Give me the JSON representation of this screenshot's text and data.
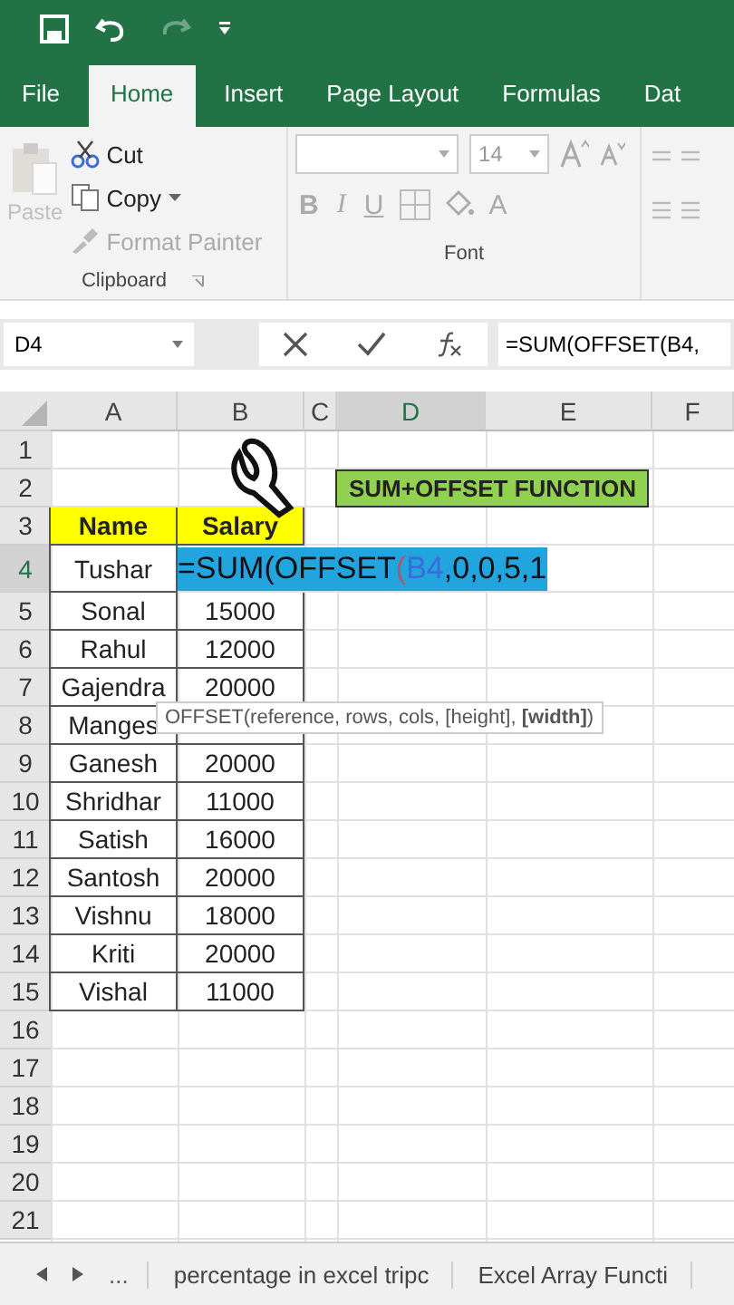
{
  "quick_access": {
    "undo_enabled": true,
    "redo_enabled": false
  },
  "tabs": [
    {
      "label": "File",
      "selected": false
    },
    {
      "label": "Home",
      "selected": true
    },
    {
      "label": "Insert",
      "selected": false
    },
    {
      "label": "Page Layout",
      "selected": false
    },
    {
      "label": "Formulas",
      "selected": false
    },
    {
      "label": "Dat",
      "selected": false
    }
  ],
  "clipboard": {
    "paste": {
      "label": "Paste",
      "disabled": true
    },
    "cut": "Cut",
    "copy": "Copy",
    "format_painter": {
      "label": "Format Painter",
      "disabled": true
    },
    "group_label": "Clipboard"
  },
  "font": {
    "size": "14",
    "style_buttons": [
      {
        "kind": "bold",
        "label": "B"
      },
      {
        "kind": "italic",
        "label": "I"
      },
      {
        "kind": "underline",
        "label": "U"
      }
    ],
    "font_color": "A",
    "group_label": "Font"
  },
  "formula_bar": {
    "name_box": "D4",
    "formula": "=SUM(OFFSET(B4,"
  },
  "columns": [
    {
      "label": "A",
      "selected": false
    },
    {
      "label": "B",
      "selected": false
    },
    {
      "label": "C",
      "selected": false
    },
    {
      "label": "D",
      "selected": true
    },
    {
      "label": "E",
      "selected": false
    },
    {
      "label": "F",
      "selected": false
    }
  ],
  "rows": [
    {
      "number": "1",
      "selected": false,
      "kind": "blank"
    },
    {
      "number": "2",
      "selected": false,
      "kind": "title",
      "title": "SUM+OFFSET FUNCTION"
    },
    {
      "number": "3",
      "selected": false,
      "kind": "header",
      "name": "Name",
      "salary": "Salary"
    },
    {
      "number": "4",
      "selected": true,
      "kind": "editing",
      "name": "Tushar",
      "segments": [
        {
          "kind": "plain",
          "text": "=SUM(OFFSET"
        },
        {
          "kind": "paren",
          "text": "("
        },
        {
          "kind": "reference",
          "text": "B4"
        },
        {
          "kind": "plain",
          "text": ",0,0,5,1"
        }
      ]
    },
    {
      "number": "5",
      "selected": false,
      "kind": "data",
      "name": "Sonal",
      "salary": "15000"
    },
    {
      "number": "6",
      "selected": false,
      "kind": "data",
      "name": "Rahul",
      "salary": "12000"
    },
    {
      "number": "7",
      "selected": false,
      "kind": "data",
      "name": "Gajendra",
      "salary": "20000"
    },
    {
      "number": "8",
      "selected": false,
      "kind": "data",
      "name": "Manges"
    },
    {
      "number": "9",
      "selected": false,
      "kind": "data",
      "name": "Ganesh",
      "salary": "20000"
    },
    {
      "number": "10",
      "selected": false,
      "kind": "data",
      "name": "Shridhar",
      "salary": "11000"
    },
    {
      "number": "11",
      "selected": false,
      "kind": "data",
      "name": "Satish",
      "salary": "16000"
    },
    {
      "number": "12",
      "selected": false,
      "kind": "data",
      "name": "Santosh",
      "salary": "20000"
    },
    {
      "number": "13",
      "selected": false,
      "kind": "data",
      "name": "Vishnu",
      "salary": "18000"
    },
    {
      "number": "14",
      "selected": false,
      "kind": "data",
      "name": "Kriti",
      "salary": "20000"
    },
    {
      "number": "15",
      "selected": false,
      "kind": "data",
      "name": "Vishal",
      "salary": "11000"
    },
    {
      "number": "16",
      "selected": false,
      "kind": "blank"
    },
    {
      "number": "17",
      "selected": false,
      "kind": "blank"
    },
    {
      "number": "18",
      "selected": false,
      "kind": "blank"
    },
    {
      "number": "19",
      "selected": false,
      "kind": "blank"
    },
    {
      "number": "20",
      "selected": false,
      "kind": "blank"
    },
    {
      "number": "21",
      "selected": false,
      "kind": "blank"
    }
  ],
  "tooltip": "OFFSET(reference, rows, cols, [height], **[width]**)",
  "sheet_tabs": {
    "more": "...",
    "tabs": [
      {
        "label": "percentage in excel tripc",
        "selected": false
      },
      {
        "label": "Excel Array Functi",
        "selected": false
      }
    ]
  }
}
